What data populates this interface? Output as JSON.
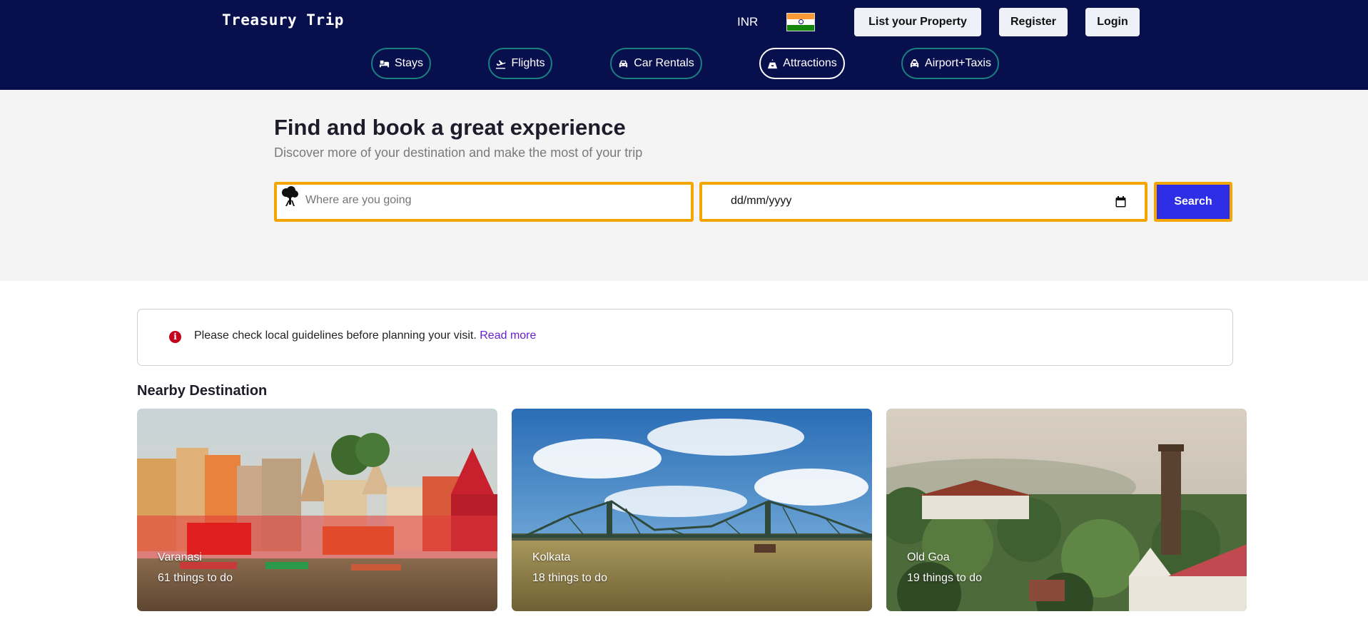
{
  "header": {
    "logo": "Treasury Trip",
    "currency": "INR",
    "flag_icon": "india-flag-icon",
    "buttons": {
      "list_property": "List your Property",
      "register": "Register",
      "login": "Login"
    },
    "nav": [
      {
        "label": "Stays",
        "icon": "bed-icon"
      },
      {
        "label": "Flights",
        "icon": "plane-icon"
      },
      {
        "label": "Car Rentals",
        "icon": "car-icon"
      },
      {
        "label": "Attractions",
        "icon": "attractions-icon",
        "active": true
      },
      {
        "label": "Airport+Taxis",
        "icon": "taxi-icon"
      }
    ]
  },
  "hero": {
    "title": "Find and book a great experience",
    "subtitle": "Discover more of your destination and make the most of your trip",
    "destination_placeholder": "Where are you going",
    "date_placeholder": "dd/mm/yyyy",
    "search_label": "Search"
  },
  "notice": {
    "text": "Please check local guidelines before planning your visit.",
    "link": "Read more"
  },
  "nearby": {
    "title": "Nearby Destination",
    "cards": [
      {
        "name": "Varanasi",
        "count": "61 things to do"
      },
      {
        "name": "Kolkata",
        "count": "18 things to do"
      },
      {
        "name": "Old Goa",
        "count": "19 things to do"
      }
    ]
  },
  "colors": {
    "header_bg": "#07104d",
    "accent_border": "#f5a500",
    "search_bg": "#2e2ee6",
    "pill_border": "#1a7f7f",
    "link": "#6a1fd0",
    "alert_icon": "#c4001b"
  }
}
